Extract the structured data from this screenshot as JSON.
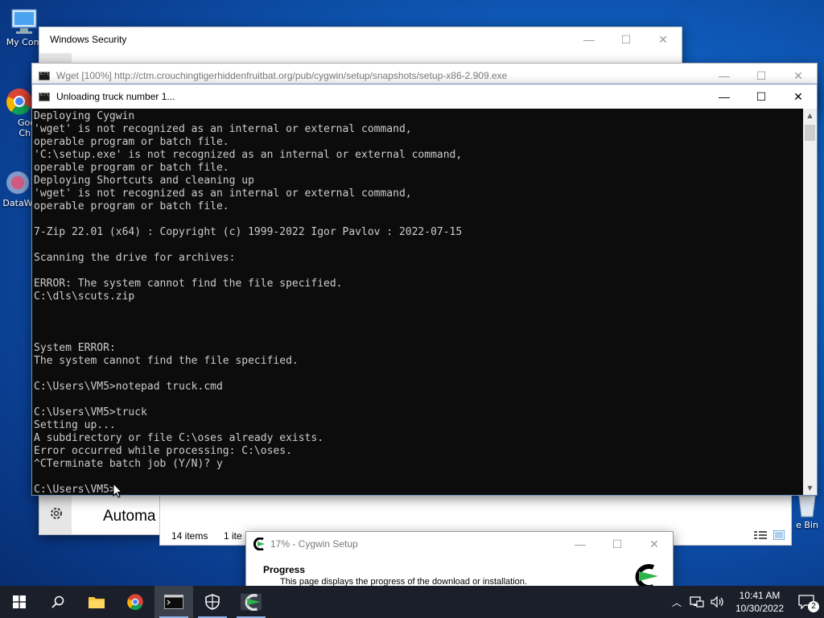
{
  "desktop": {
    "icons": [
      {
        "label": "My Com"
      },
      {
        "label": "Goo Chr"
      },
      {
        "label": "DataW"
      },
      {
        "label": "e Bin"
      }
    ]
  },
  "windows_security": {
    "title": "Windows Security",
    "side_label": "Automa"
  },
  "explorer": {
    "status_items": "14 items",
    "status_selected": "1 ite"
  },
  "wget_window": {
    "title": "Wget [100%] http://ctm.crouchingtigerhiddenfruitbat.org/pub/cygwin/setup/snapshots/setup-x86-2.909.exe"
  },
  "console": {
    "title": "Unloading truck number 1...",
    "lines": [
      "Deploying Cygwin",
      "'wget' is not recognized as an internal or external command,",
      "operable program or batch file.",
      "'C:\\setup.exe' is not recognized as an internal or external command,",
      "operable program or batch file.",
      "Deploying Shortcuts and cleaning up",
      "'wget' is not recognized as an internal or external command,",
      "operable program or batch file.",
      "",
      "7-Zip 22.01 (x64) : Copyright (c) 1999-2022 Igor Pavlov : 2022-07-15",
      "",
      "Scanning the drive for archives:",
      "",
      "ERROR: The system cannot find the file specified.",
      "C:\\dls\\scuts.zip",
      "",
      "",
      "",
      "System ERROR:",
      "The system cannot find the file specified.",
      "",
      "C:\\Users\\VM5>notepad truck.cmd",
      "",
      "C:\\Users\\VM5>truck",
      "Setting up...",
      "A subdirectory or file C:\\oses already exists.",
      "Error occurred while processing: C:\\oses.",
      "^CTerminate batch job (Y/N)? y",
      "",
      "C:\\Users\\VM5>"
    ]
  },
  "cygwin_setup": {
    "title": "17% - Cygwin Setup",
    "heading": "Progress",
    "description": "This page displays the progress of the download or installation."
  },
  "taskbar": {
    "clock_time": "10:41 AM",
    "clock_date": "10/30/2022",
    "notification_count": "2"
  },
  "window_controls": {
    "minimize": "—",
    "maximize": "☐",
    "close": "✕"
  },
  "colors": {
    "console_bg": "#0c0c0c",
    "console_fg": "#cccccc",
    "cygwin_green": "#2db34a",
    "taskbar_bg": "#1b1f2a"
  }
}
